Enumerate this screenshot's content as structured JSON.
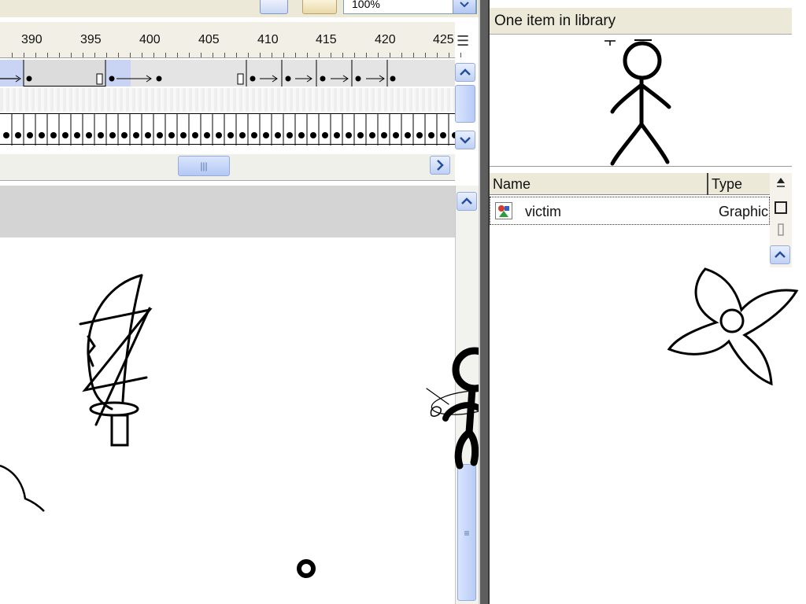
{
  "toolbar": {
    "zoom_value": "100%"
  },
  "timeline": {
    "ruler_numbers": [
      "390",
      "395",
      "400",
      "405",
      "410",
      "415",
      "420",
      "425"
    ]
  },
  "library": {
    "header": "One item in library",
    "columns": {
      "name": "Name",
      "type": "Type"
    },
    "items": [
      {
        "name": "victim",
        "type": "Graphic"
      }
    ]
  },
  "icons": {
    "scroll_up": "chevron-up-icon",
    "scroll_down": "chevron-down-icon",
    "scroll_right": "chevron-right-icon",
    "panel_menu": "panel-menu-icon"
  },
  "colors": {
    "splitter": "#5e5e5e",
    "scroll_accent": "#244f9e",
    "stage": "#ffffff",
    "workspace": "#d4d4d4"
  }
}
